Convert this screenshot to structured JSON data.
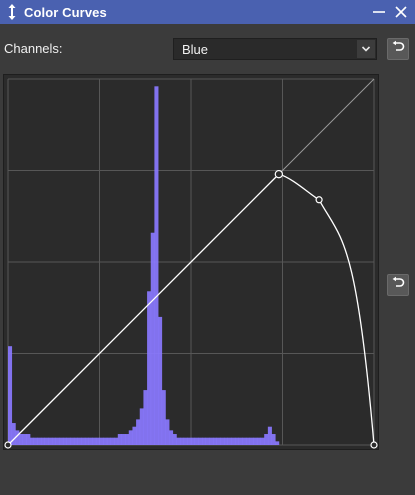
{
  "window": {
    "title": "Color Curves",
    "move_icon": "vertical-resize-arrows-icon",
    "minimize_icon": "minimize-icon",
    "close_icon": "close-icon"
  },
  "channels": {
    "label": "Channels:",
    "selected": "Blue",
    "caret_icon": "chevron-down-icon",
    "reset_icon": "undo-arrow-icon"
  },
  "curve": {
    "histogram_color": "#8a78ff",
    "grid_color": "#575757",
    "curve_color": "#ffffff",
    "control_points": [
      {
        "input": 0.0,
        "output": 0.0
      },
      {
        "input": 0.74,
        "output": 0.74
      },
      {
        "input": 0.85,
        "output": 0.67
      },
      {
        "input": 1.0,
        "output": 0.0
      }
    ],
    "histogram": [
      0.27,
      0.06,
      0.04,
      0.03,
      0.03,
      0.03,
      0.02,
      0.02,
      0.02,
      0.02,
      0.02,
      0.02,
      0.02,
      0.02,
      0.02,
      0.02,
      0.02,
      0.02,
      0.02,
      0.02,
      0.02,
      0.02,
      0.02,
      0.02,
      0.02,
      0.02,
      0.02,
      0.02,
      0.02,
      0.02,
      0.03,
      0.03,
      0.03,
      0.04,
      0.05,
      0.07,
      0.1,
      0.15,
      0.42,
      0.58,
      0.98,
      0.35,
      0.15,
      0.07,
      0.04,
      0.03,
      0.02,
      0.02,
      0.02,
      0.02,
      0.02,
      0.02,
      0.02,
      0.02,
      0.02,
      0.02,
      0.02,
      0.02,
      0.02,
      0.02,
      0.02,
      0.02,
      0.02,
      0.02,
      0.02,
      0.02,
      0.02,
      0.02,
      0.02,
      0.02,
      0.03,
      0.05,
      0.03,
      0.01,
      0.0,
      0.0,
      0.0,
      0.0,
      0.0,
      0.0,
      0.0,
      0.0,
      0.0,
      0.0,
      0.0,
      0.0,
      0.0,
      0.0,
      0.0,
      0.0,
      0.0,
      0.0,
      0.0,
      0.0,
      0.0,
      0.0,
      0.0,
      0.0,
      0.0,
      0.0
    ]
  }
}
